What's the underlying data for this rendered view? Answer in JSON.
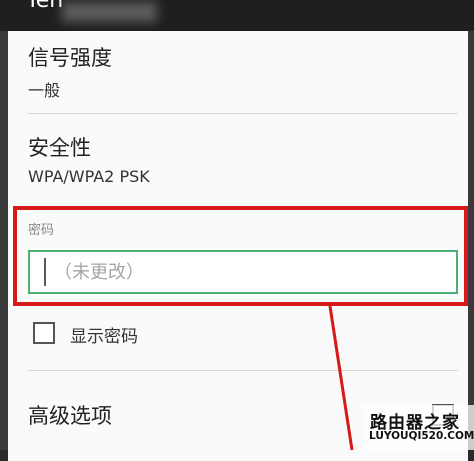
{
  "header": {
    "title": "Ten"
  },
  "signal": {
    "label": "信号强度",
    "value": "一般"
  },
  "security": {
    "label": "安全性",
    "value": "WPA/WPA2 PSK"
  },
  "password": {
    "label": "密码",
    "placeholder": "（未更改）",
    "value": ""
  },
  "show_password": {
    "label": "显示密码",
    "checked": false
  },
  "advanced": {
    "label": "高级选项",
    "checked": false
  },
  "watermark": {
    "title": "路由器之家",
    "url": "LUYOUQI520.COM"
  },
  "colors": {
    "highlight": "#d61a1a",
    "focus": "#4caf73"
  }
}
